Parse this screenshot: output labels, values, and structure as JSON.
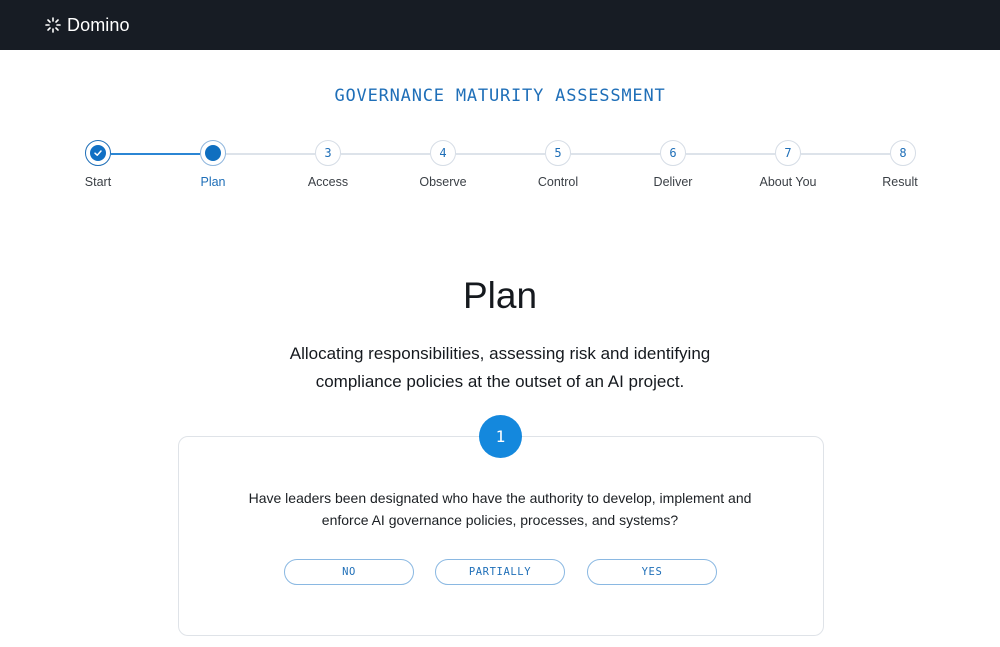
{
  "header": {
    "brand": "Domino",
    "brand_icon": "domino-logo-icon",
    "bg_color": "#171c24"
  },
  "assessment": {
    "title": "GOVERNANCE MATURITY ASSESSMENT",
    "accent_color": "#1f6fb8"
  },
  "steps": [
    {
      "number": "",
      "label": "Start",
      "state": "complete"
    },
    {
      "number": "",
      "label": "Plan",
      "state": "current"
    },
    {
      "number": "3",
      "label": "Access",
      "state": "upcoming"
    },
    {
      "number": "4",
      "label": "Observe",
      "state": "upcoming"
    },
    {
      "number": "5",
      "label": "Control",
      "state": "upcoming"
    },
    {
      "number": "6",
      "label": "Deliver",
      "state": "upcoming"
    },
    {
      "number": "7",
      "label": "About You",
      "state": "upcoming"
    },
    {
      "number": "8",
      "label": "Result",
      "state": "upcoming"
    }
  ],
  "section": {
    "title": "Plan",
    "description": "Allocating responsibilities, assessing risk and identifying compliance policies at the outset of an AI project."
  },
  "question": {
    "number": "1",
    "text": "Have leaders been designated who have the authority to develop, implement and enforce AI governance policies, processes, and systems?",
    "answers": [
      "NO",
      "PARTIALLY",
      "YES"
    ]
  }
}
